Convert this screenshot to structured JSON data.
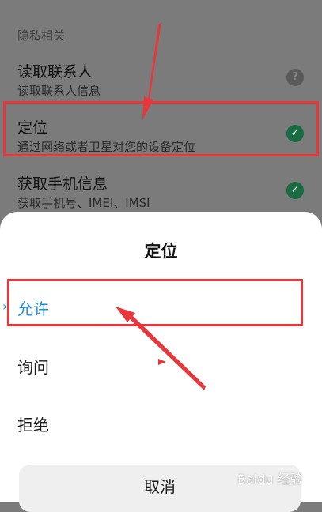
{
  "settings": {
    "section_header": "隐私相关",
    "permissions": [
      {
        "title": "读取联系人",
        "description": "读取联系人信息",
        "status_icon": "question-circle-icon"
      },
      {
        "title": "定位",
        "description": "通过网络或者卫星对您的设备定位",
        "status_icon": "check-circle-icon"
      },
      {
        "title": "获取手机信息",
        "description": "获取手机号、IMEI、IMSI",
        "status_icon": "check-circle-icon"
      }
    ]
  },
  "sheet": {
    "title": "定位",
    "options": [
      {
        "label": "允许",
        "selected": true
      },
      {
        "label": "询问",
        "selected": false
      },
      {
        "label": "拒绝",
        "selected": false
      }
    ],
    "cancel_label": "取消"
  },
  "icons": {
    "unknown_glyph": "?",
    "check_glyph": "✓",
    "selected_glyph": "›"
  },
  "watermark": "Baidu 经验",
  "colors": {
    "accent": "#1f8bdb",
    "highlight": "#e8363a",
    "check": "#1a6b43",
    "overlay": "#7b7b7b"
  }
}
